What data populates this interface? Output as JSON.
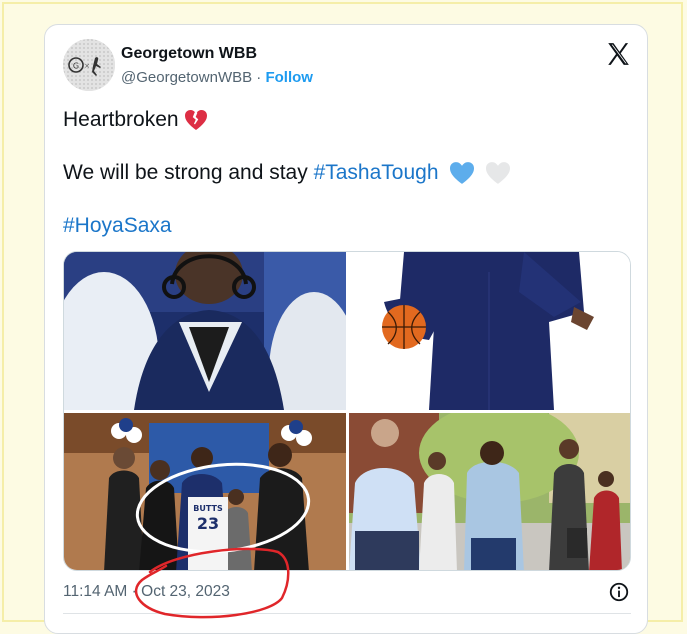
{
  "tweet": {
    "author_name": "Georgetown WBB",
    "author_handle": "@GeorgetownWBB",
    "separator": "·",
    "follow_label": "Follow",
    "line1_text": "Heartbroken",
    "line2_text": "We will be strong and stay",
    "line2_hashtag": "#TashaTough",
    "line3_hashtag": "#HoyaSaxa",
    "time": "11:14 AM",
    "date": "Oct 23, 2023",
    "jersey_name": "BUTTS",
    "jersey_number": "23"
  },
  "colors": {
    "link": "#1b76c9",
    "follow": "#1d9bf0",
    "annotation_red": "#e0262a"
  },
  "icons": {
    "close": "x-logo-icon",
    "info": "info-icon",
    "broken_heart": "broken-heart-icon",
    "blue_heart": "blue-heart-icon",
    "white_heart": "white-heart-icon"
  }
}
